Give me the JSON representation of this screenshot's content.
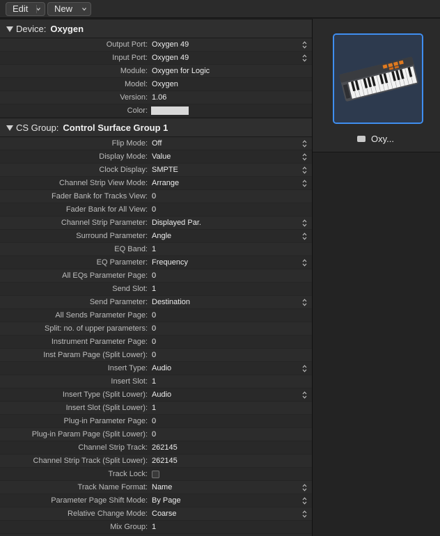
{
  "toolbar": {
    "edit_label": "Edit",
    "new_label": "New"
  },
  "device": {
    "section_label": "Device:",
    "section_value": "Oxygen",
    "rows": [
      {
        "label": "Output Port:",
        "value": "Oxygen 49",
        "stepper": true
      },
      {
        "label": "Input Port:",
        "value": "Oxygen 49",
        "stepper": true
      },
      {
        "label": "Module:",
        "value": "Oxygen for Logic",
        "stepper": false
      },
      {
        "label": "Model:",
        "value": "Oxygen",
        "stepper": false
      },
      {
        "label": "Version:",
        "value": "1.06",
        "stepper": false
      },
      {
        "label": "Color:",
        "value": "",
        "swatch": "#d9d9d9"
      }
    ]
  },
  "cs_group": {
    "section_label": "CS Group:",
    "section_value": "Control Surface Group 1",
    "rows": [
      {
        "label": "Flip Mode:",
        "value": "Off",
        "stepper": true
      },
      {
        "label": "Display Mode:",
        "value": "Value",
        "stepper": true
      },
      {
        "label": "Clock Display:",
        "value": "SMPTE",
        "stepper": true
      },
      {
        "label": "Channel Strip View Mode:",
        "value": "Arrange",
        "stepper": true
      },
      {
        "label": "Fader Bank for Tracks View:",
        "value": "0",
        "stepper": false
      },
      {
        "label": "Fader Bank for All View:",
        "value": "0",
        "stepper": false
      },
      {
        "label": "Channel Strip Parameter:",
        "value": "Displayed Par.",
        "stepper": true
      },
      {
        "label": "Surround Parameter:",
        "value": "Angle",
        "stepper": true
      },
      {
        "label": "EQ Band:",
        "value": "1",
        "stepper": false
      },
      {
        "label": "EQ Parameter:",
        "value": "Frequency",
        "stepper": true
      },
      {
        "label": "All EQs Parameter Page:",
        "value": "0",
        "stepper": false
      },
      {
        "label": "Send Slot:",
        "value": "1",
        "stepper": false
      },
      {
        "label": "Send Parameter:",
        "value": "Destination",
        "stepper": true
      },
      {
        "label": "All Sends Parameter Page:",
        "value": "0",
        "stepper": false
      },
      {
        "label": "Split: no. of upper parameters:",
        "value": "0",
        "stepper": false
      },
      {
        "label": "Instrument Parameter Page:",
        "value": "0",
        "stepper": false
      },
      {
        "label": "Inst Param Page (Split Lower):",
        "value": "0",
        "stepper": false
      },
      {
        "label": "Insert Type:",
        "value": "Audio",
        "stepper": true
      },
      {
        "label": "Insert Slot:",
        "value": "1",
        "stepper": false
      },
      {
        "label": "Insert Type (Split Lower):",
        "value": "Audio",
        "stepper": true
      },
      {
        "label": "Insert Slot (Split Lower):",
        "value": "1",
        "stepper": false
      },
      {
        "label": "Plug-in Parameter Page:",
        "value": "0",
        "stepper": false
      },
      {
        "label": "Plug-in Param Page (Split Lower):",
        "value": "0",
        "stepper": false
      },
      {
        "label": "Channel Strip Track:",
        "value": "262145",
        "stepper": false
      },
      {
        "label": "Channel Strip Track (Split Lower):",
        "value": "262145",
        "stepper": false
      },
      {
        "label": "Track Lock:",
        "value": "",
        "checkbox": true,
        "checked": false
      },
      {
        "label": "Track Name Format:",
        "value": "Name",
        "stepper": true
      },
      {
        "label": "Parameter Page Shift Mode:",
        "value": "By Page",
        "stepper": true
      },
      {
        "label": "Relative Change Mode:",
        "value": "Coarse",
        "stepper": true
      },
      {
        "label": "Mix Group:",
        "value": "1",
        "stepper": false
      }
    ]
  },
  "preview": {
    "caption": "Oxy...",
    "icon": "keyboard-controller-icon"
  },
  "colors": {
    "selection": "#3f8ef0",
    "panel": "#2a2a2a"
  }
}
